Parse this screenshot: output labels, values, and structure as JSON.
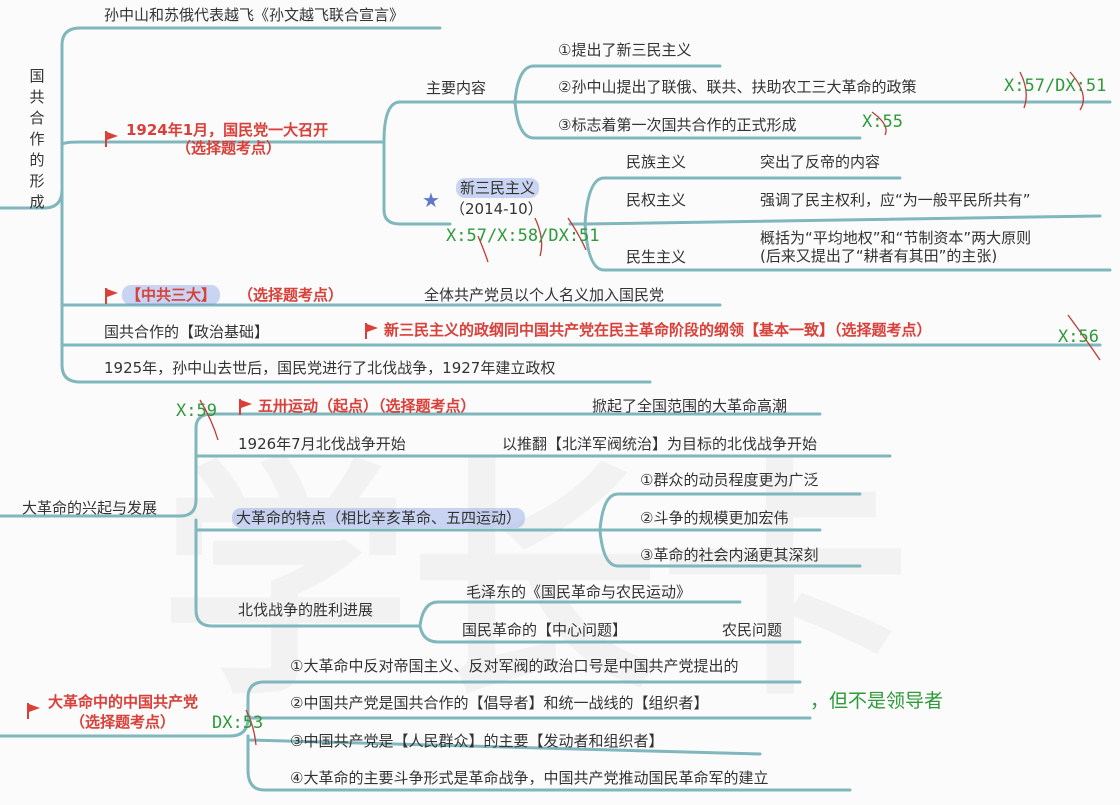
{
  "section1": {
    "title": "国共合作的形成",
    "top_item": "孙中山和苏俄代表越飞《孙文越飞联合宣言》",
    "congress1": {
      "title": "1924年1月，国民党一大召开",
      "note": "（选择题考点）",
      "main_content_label": "主要内容",
      "points": [
        "①提出了新三民主义",
        "②孙中山提出了联俄、联共、扶助农工三大革命的政策",
        "③标志着第一次国共合作的正式形成"
      ],
      "point2_mark": "X:57/DX:51",
      "point3_mark": "X:55",
      "new_three": {
        "title": "新三民主义",
        "year": "（2014-10）",
        "mark": "X:57/X:58/DX:51",
        "rows": [
          {
            "name": "民族主义",
            "desc": "突出了反帝的内容"
          },
          {
            "name": "民权主义",
            "desc": "强调了民主权利，应“为一般平民所共有”"
          },
          {
            "name": "民生主义",
            "desc": "概括为“平均地权”和“节制资本”两大原则",
            "desc2": "(后来又提出了“耕者有其田”的主张)"
          }
        ]
      }
    },
    "ccp3": {
      "title": "【中共三大】",
      "note": "（选择题考点）",
      "desc": "全体共产党员以个人名义加入国民党"
    },
    "basis": {
      "label": "国共合作的【政治基础】",
      "desc": "新三民主义的政纲同中国共产党在民主革命阶段的纲领【基本一致】（选择题考点）",
      "mark": "X:56"
    },
    "northern": "1925年，孙中山去世后，国民党进行了北伐战争，1927年建立政权"
  },
  "section2": {
    "title": "大革命的兴起与发展",
    "may30": {
      "mark": "X:59",
      "title": "五卅运动（起点）（选择题考点）",
      "desc": "掀起了全国范围的大革命高潮"
    },
    "expedition_start": {
      "label": "1926年7月北伐战争开始",
      "desc": "以推翻【北洋军阀统治】为目标的北伐战争开始"
    },
    "features": {
      "label": "大革命的特点（相比辛亥革命、五四运动）",
      "points": [
        "①群众的动员程度更为广泛",
        "②斗争的规模更加宏伟",
        "③革命的社会内涵更其深刻"
      ]
    },
    "victory": {
      "label": "北伐战争的胜利进展",
      "points": [
        "毛泽东的《国民革命与农民运动》",
        "国民革命的【中心问题】"
      ],
      "answer": "农民问题"
    }
  },
  "section3": {
    "title": "大革命中的中国共产党",
    "note": "（选择题考点）",
    "mark": "DX:53",
    "points": [
      "①大革命中反对帝国主义、反对军阀的政治口号是中国共产党提出的",
      "②中国共产党是国共合作的【倡导者】和统一战线的【组织者】",
      "③中国共产党是【人民群众】的主要【发动者和组织者】",
      "④大革命的主要斗争形式是革命战争，中国共产党推动国民革命军的建立"
    ],
    "point2_extra": "，但不是领导者"
  },
  "colors": {
    "line": "#7fb7bd",
    "red": "#d9403a",
    "green": "#2e9a3a",
    "highlight": "#8aa2e8"
  },
  "watermark": "学长卡"
}
